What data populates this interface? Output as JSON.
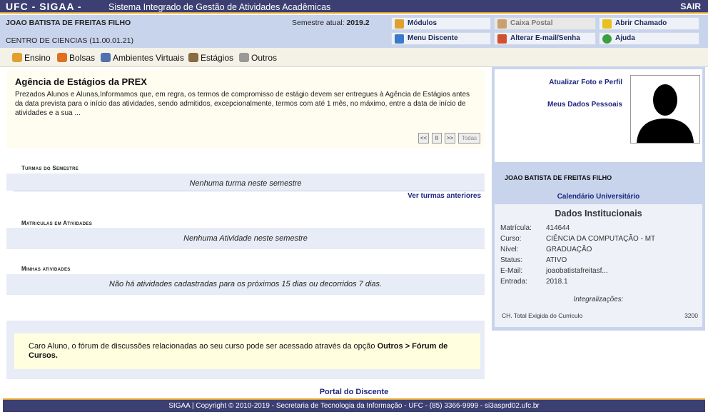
{
  "header": {
    "brand": "UFC - SIGAA -",
    "system_name": "Sistema Integrado de Gestão de Atividades Acadêmicas",
    "logout": "SAIR"
  },
  "user": {
    "name": "JOAO BATISTA DE FREITAS FILHO",
    "semester_label": "Semestre atual:",
    "semester_value": "2019.2",
    "unit": "CENTRO DE CIENCIAS (11.00.01.21)"
  },
  "quick_menu": {
    "modulos": "Módulos",
    "caixa_postal": "Caixa Postal",
    "abrir_chamado": "Abrir Chamado",
    "menu_discente": "Menu Discente",
    "alterar_email": "Alterar E-mail/Senha",
    "ajuda": "Ajuda"
  },
  "menu": {
    "ensino": "Ensino",
    "bolsas": "Bolsas",
    "ambientes": "Ambientes Virtuais",
    "estagios": "Estágios",
    "outros": "Outros"
  },
  "notice": {
    "title": "Agência de Estágios da PREX",
    "body": "Prezados Alunos e Alunas,Informamos que, em regra, os termos de compromisso de estágio devem ser entregues à Agência de Estágios antes da data prevista para o início das atividades, sendo admitidos, excepcionalmente, termos com até 1 mês, no máximo, entre a data de início de atividades e a sua ...",
    "prev": "<<",
    "pause": "II",
    "next": ">>",
    "all": "Todas"
  },
  "sections": {
    "turmas_title": "Turmas do Semestre",
    "turmas_empty": "Nenhuma turma neste semestre",
    "turmas_link": "Ver turmas anteriores",
    "matriculas_title": "Matriculas em Atividades",
    "matriculas_empty": "Nenhuma Atividade neste semestre",
    "atividades_title": "Minhas atividades",
    "atividades_empty": "Não há atividades cadastradas para os próximos 15 dias ou decorridos 7 dias."
  },
  "forum": {
    "text": "Caro Aluno, o fórum de discussões relacionadas ao seu curso pode ser acessado através da opção ",
    "bold": "Outros > Fórum de Cursos."
  },
  "profile": {
    "update_photo": "Atualizar Foto e Perfil",
    "my_data": "Meus Dados Pessoais",
    "name": "JOAO BATISTA DE FREITAS FILHO",
    "calendar": "Calendário Universitário"
  },
  "institutional": {
    "title": "Dados Institucionais",
    "rows": [
      {
        "label": "Matrícula:",
        "value": "414644"
      },
      {
        "label": "Curso:",
        "value": "CIÊNCIA DA COMPUTAÇÃO - MT"
      },
      {
        "label": "Nível:",
        "value": "GRADUAÇÃO"
      },
      {
        "label": "Status:",
        "value": "ATIVO"
      },
      {
        "label": "E-Mail:",
        "value": "joaobatistafreitasf..."
      },
      {
        "label": "Entrada:",
        "value": "2018.1"
      }
    ],
    "integralizacoes": "Integralizações:",
    "ch_label": "CH. Total Exigida do Curriculo",
    "ch_value": "3200"
  },
  "footer": {
    "portal": "Portal do Discente",
    "copyright": "SIGAA | Copyright © 2010-2019 - Secretaria de Tecnologia da Informação - UFC - (85) 3366-9999 - si3asprd02.ufc.br"
  },
  "colors": {
    "top_bar": "#3b3f72",
    "accent": "#e0a22a",
    "info_band": "#c8d4ec",
    "link": "#1f2780"
  }
}
